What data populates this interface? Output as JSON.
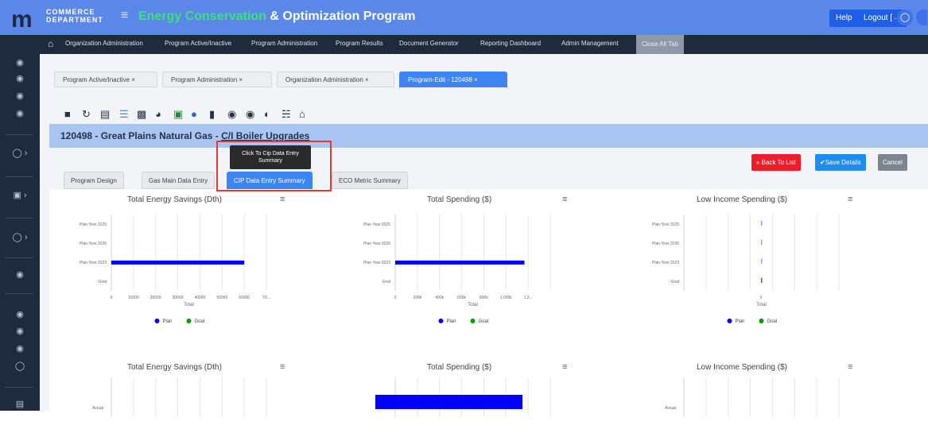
{
  "header": {
    "logo_mark": "m",
    "logo_line1": "COMMERCE",
    "logo_line2": "DEPARTMENT",
    "title_part1": "Energy Conservation",
    "title_amp": " & ",
    "title_part2": "Optimization Program",
    "help_label": "Help",
    "logout_label": "Logout [→",
    "accent": "#5a87e8",
    "title_green": "#3ee07c"
  },
  "nav": {
    "items": [
      "Organization Administration",
      "Program Active/Inactive",
      "Program Administration",
      "Program Results",
      "Document Generator",
      "Reporting Dashboard",
      "Admin Management"
    ],
    "close_all": "Close All Tab"
  },
  "tabs": [
    {
      "label": "Program Active/Inactive  ×"
    },
    {
      "label": "Program Administration  ×"
    },
    {
      "label": "Organization Administration  ×"
    },
    {
      "label": "Program-Edit - 120498  ×"
    }
  ],
  "record": {
    "title_prefix": "120498 - Great Plains Natural Gas - ",
    "title_suffix": "C/I Boiler Upgrades"
  },
  "tooltip": {
    "line1": "Click To Cip Data Entry",
    "line2": "Summary"
  },
  "buttons": {
    "back": "« Back To List",
    "save": "✔Save Details",
    "cancel": "Cancel"
  },
  "subtabs": [
    "Program Design",
    "Gas Main Data Entry",
    "CIP Data Entry Summary",
    "ECO Metric Summary"
  ],
  "chart_data": [
    {
      "type": "bar",
      "title": "Total Energy Savings (Dth)",
      "categories": [
        "Plan Year 2025",
        "Plan Year 2026",
        "Plan Year 2023",
        "Goal"
      ],
      "xlabel": "Total",
      "x_ticks": [
        "0",
        "10000",
        "20000",
        "30000",
        "40000",
        "50000",
        "60000",
        "70..."
      ],
      "series": [
        {
          "name": "Plan",
          "color": "#0000ff",
          "values": [
            0,
            0,
            60000,
            0
          ]
        },
        {
          "name": "Goal",
          "color": "#00a000",
          "values": [
            0,
            0,
            0,
            0
          ]
        }
      ],
      "xlim": [
        0,
        70000
      ],
      "legend": "bottom"
    },
    {
      "type": "bar",
      "title": "Total Spending ($)",
      "categories": [
        "Plan Year 2025",
        "Plan Year 2026",
        "Plan Year 2023",
        "Goal"
      ],
      "xlabel": "Total",
      "x_ticks": [
        "0",
        "200k",
        "400k",
        "600k",
        "800k",
        "1.000k",
        "1.2..."
      ],
      "series": [
        {
          "name": "Plan",
          "color": "#0000ff",
          "values": [
            0,
            0,
            1000000,
            0
          ]
        },
        {
          "name": "Goal",
          "color": "#00a000",
          "values": [
            0,
            0,
            0,
            0
          ]
        }
      ],
      "xlim": [
        0,
        1200000
      ],
      "legend": "bottom"
    },
    {
      "type": "bar",
      "title": "Low Income Spending ($)",
      "categories": [
        "Plan Year 2025",
        "Plan Year 2026",
        "Plan Year 2023",
        "Goal"
      ],
      "xlabel": "Total",
      "x_ticks": [
        "0"
      ],
      "series": [
        {
          "name": "Plan",
          "color": "#0000ff",
          "values": [
            0,
            0,
            0,
            0
          ]
        },
        {
          "name": "Goal",
          "color": "#00a000",
          "values": [
            0,
            0,
            0,
            0
          ]
        }
      ],
      "xlim": [
        0,
        1
      ],
      "legend": "bottom"
    },
    {
      "type": "bar",
      "title": "Total Energy Savings (Dth)",
      "categories": [
        "Actual"
      ],
      "series": []
    },
    {
      "type": "bar",
      "title": "Total Spending ($)",
      "categories": [
        "Actual"
      ],
      "series": [
        {
          "name": "Actual",
          "color": "#0000ff",
          "values": [
            1
          ]
        }
      ]
    },
    {
      "type": "bar",
      "title": "Low Income Spending ($)",
      "categories": [
        "Actual"
      ],
      "series": []
    }
  ]
}
